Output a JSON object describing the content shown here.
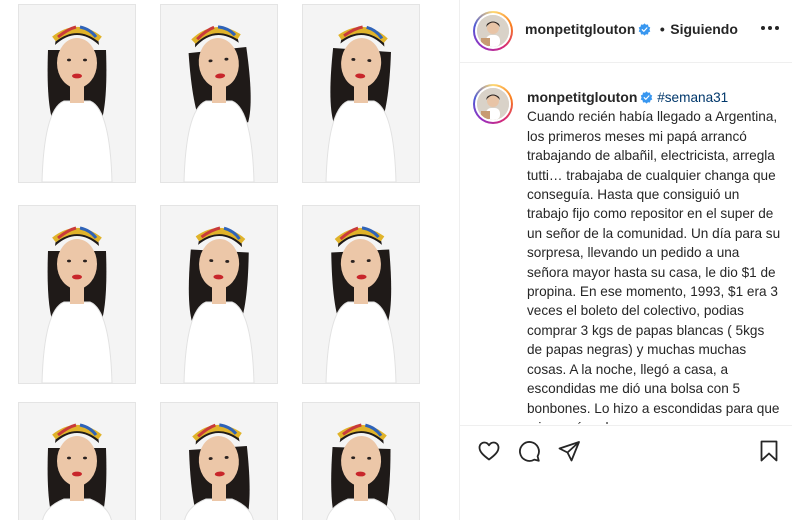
{
  "post": {
    "author": "monpetitglouton",
    "follow_separator": "•",
    "follow_label": "Siguiendo",
    "caption_hashtag": "#semana31",
    "caption_body": "Cuando recién había llegado a Argentina, los primeros meses mi papá arrancó trabajando de albañil, electricista, arregla tutti… trabajaba de cualquier changa que conseguía. Hasta que consiguió un trabajo fijo como repositor en el super de un señor de la comunidad. Un día para su sorpresa, llevando un pedido a una señora mayor hasta su casa, le dio $1 de propina. En ese momento, 1993, $1 era 3 veces el boleto del colectivo, podias comprar 3 kgs de papas blancas ( 5kgs de papas negras) y muchas muchas cosas. A la noche, llegó a casa, a escondidas me dió una bolsa con 5 bonbones. Lo hizo a escondidas para que mi mamá no lo"
  },
  "icons": {
    "verified": "verified-badge-icon",
    "more": "more-options-icon",
    "like": "heart-icon",
    "comment": "comment-bubble-icon",
    "share": "paper-plane-icon",
    "save": "bookmark-icon"
  },
  "colors": {
    "verified_blue": "#3897f0",
    "hashtag": "#00376b",
    "text": "#262626",
    "divider": "#efefef"
  }
}
